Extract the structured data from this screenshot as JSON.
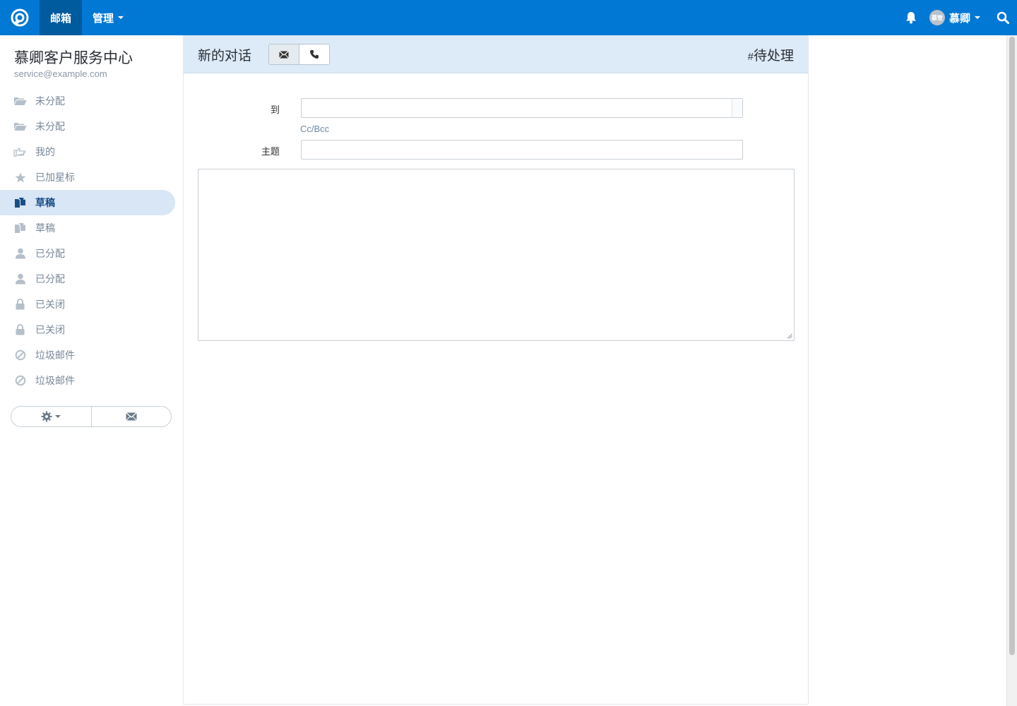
{
  "colors": {
    "topbar": "#0078d4",
    "topbar_active": "#005a9e",
    "sidebar_active_bg": "#d8e6f5",
    "header_bg": "#ddeaf7"
  },
  "topnav": {
    "logo_icon": "helpscout-logo-icon",
    "items": [
      {
        "label": "邮箱"
      },
      {
        "label": "管理"
      }
    ],
    "user": {
      "avatar_text": "慕管",
      "name": "慕卿"
    }
  },
  "sidebar": {
    "mailbox_name": "慕卿客户服务中心",
    "mailbox_email": "service@example.com",
    "folders": [
      {
        "label": "未分配",
        "icon": "folder-open-icon"
      },
      {
        "label": "未分配",
        "icon": "folder-open-icon"
      },
      {
        "label": "我的",
        "icon": "hand-point-icon"
      },
      {
        "label": "已加星标",
        "icon": "star-icon"
      },
      {
        "label": "草稿",
        "icon": "drafts-icon"
      },
      {
        "label": "草稿",
        "icon": "drafts-icon"
      },
      {
        "label": "已分配",
        "icon": "user-icon"
      },
      {
        "label": "已分配",
        "icon": "user-icon"
      },
      {
        "label": "已关闭",
        "icon": "lock-icon"
      },
      {
        "label": "已关闭",
        "icon": "lock-icon"
      },
      {
        "label": "垃圾邮件",
        "icon": "ban-icon"
      },
      {
        "label": "垃圾邮件",
        "icon": "ban-icon"
      }
    ],
    "active_index": 4
  },
  "main": {
    "title": "新的对话",
    "status_hash": "#",
    "status": "待处理",
    "form": {
      "to_label": "到",
      "to_value": "",
      "cc_bcc_label": "Cc/Bcc",
      "subject_label": "主题",
      "subject_value": "",
      "body_value": ""
    }
  }
}
